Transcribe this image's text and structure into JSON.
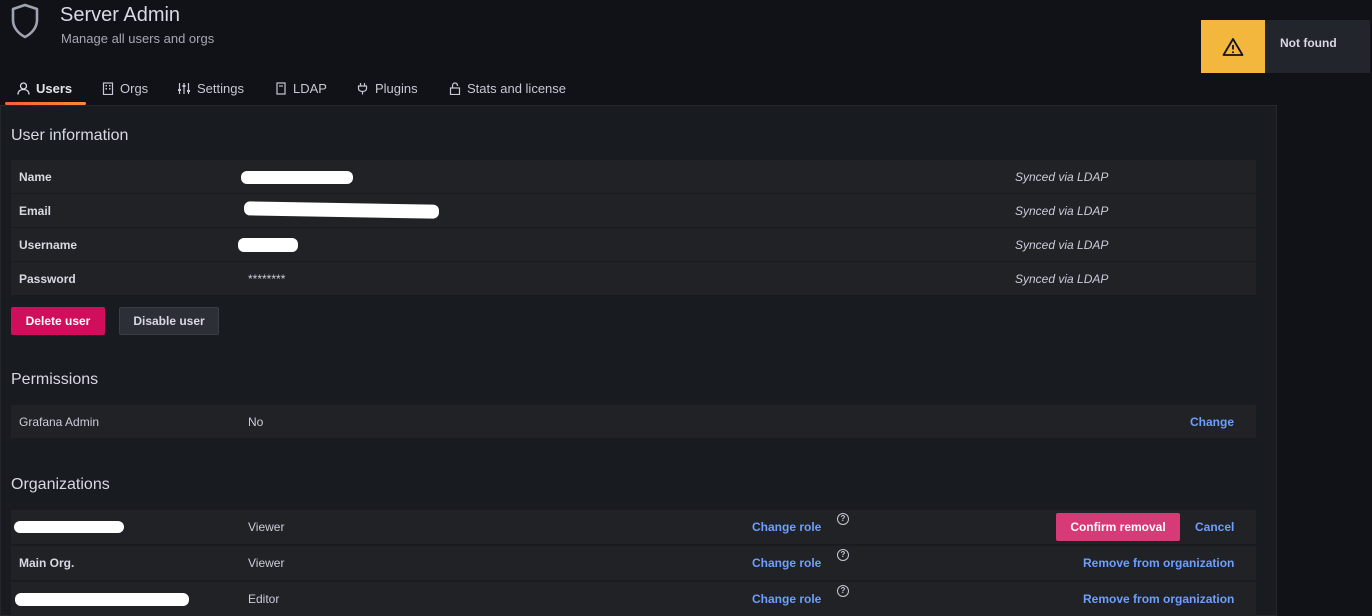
{
  "header": {
    "title": "Server Admin",
    "subtitle": "Manage all users and orgs",
    "icon": "shield-icon"
  },
  "toast": {
    "text": "Not found",
    "icon": "warning-icon",
    "color": "#f2b73c"
  },
  "tabs": [
    {
      "label": "Users",
      "icon": "user-icon",
      "active": true
    },
    {
      "label": "Orgs",
      "icon": "building-icon",
      "active": false
    },
    {
      "label": "Settings",
      "icon": "sliders-icon",
      "active": false
    },
    {
      "label": "LDAP",
      "icon": "book-icon",
      "active": false
    },
    {
      "label": "Plugins",
      "icon": "plug-icon",
      "active": false
    },
    {
      "label": "Stats and license",
      "icon": "lock-icon",
      "active": false
    }
  ],
  "user_info": {
    "title": "User information",
    "rows": [
      {
        "label": "Name",
        "value": "",
        "status": "Synced via LDAP"
      },
      {
        "label": "Email",
        "value": "",
        "status": "Synced via LDAP"
      },
      {
        "label": "Username",
        "value": "",
        "status": "Synced via LDAP"
      },
      {
        "label": "Password",
        "value": "********",
        "status": "Synced via LDAP"
      }
    ],
    "delete_label": "Delete user",
    "disable_label": "Disable user"
  },
  "permissions": {
    "title": "Permissions",
    "label": "Grafana Admin",
    "value": "No",
    "change_label": "Change"
  },
  "organizations": {
    "title": "Organizations",
    "rows": [
      {
        "name": "",
        "role": "Viewer",
        "change_role": "Change role",
        "action_primary": "Confirm removal",
        "action_secondary": "Cancel"
      },
      {
        "name": "Main Org.",
        "role": "Viewer",
        "change_role": "Change role",
        "action": "Remove from organization"
      },
      {
        "name": "",
        "role": "Editor",
        "change_role": "Change role",
        "action": "Remove from organization"
      }
    ]
  },
  "colors": {
    "accent_link": "#6e9fff",
    "danger": "#d10e5c",
    "tab_underline": "#f55f3e"
  }
}
